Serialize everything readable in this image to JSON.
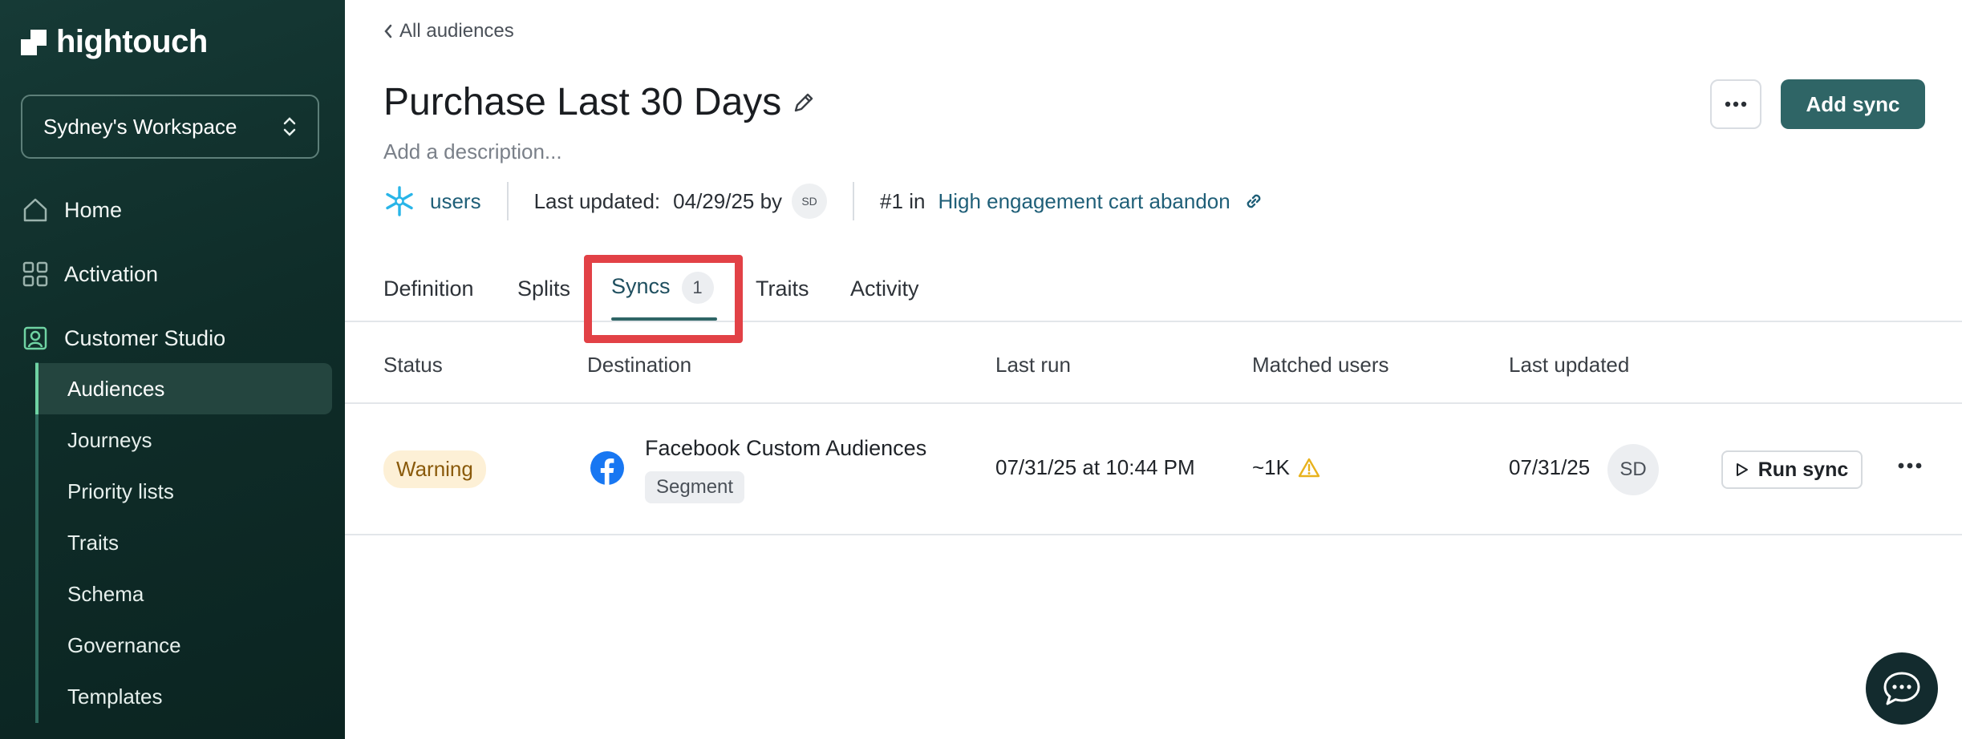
{
  "sidebar": {
    "brand": "hightouch",
    "workspace": "Sydney's Workspace",
    "nav": [
      {
        "label": "Home",
        "icon": "home-icon"
      },
      {
        "label": "Activation",
        "icon": "activation-icon"
      },
      {
        "label": "Customer Studio",
        "icon": "customer-studio-icon"
      }
    ],
    "sub_items": [
      "Audiences",
      "Journeys",
      "Priority lists",
      "Traits",
      "Schema",
      "Governance",
      "Templates"
    ],
    "active_sub": "Audiences"
  },
  "header": {
    "back_label": "All audiences",
    "title": "Purchase Last 30 Days",
    "description_placeholder": "Add a description...",
    "source": "users",
    "last_updated_label": "Last updated:",
    "last_updated_value": "04/29/25 by",
    "updated_by_initials": "SD",
    "rank_label": "#1 in",
    "rank_link": "High engagement cart abandon",
    "add_sync_label": "Add sync"
  },
  "tabs": [
    {
      "label": "Definition"
    },
    {
      "label": "Splits"
    },
    {
      "label": "Syncs",
      "count": "1",
      "active": true
    },
    {
      "label": "Traits"
    },
    {
      "label": "Activity"
    }
  ],
  "table": {
    "columns": [
      "Status",
      "Destination",
      "Last run",
      "Matched users",
      "Last updated"
    ],
    "rows": [
      {
        "status": "Warning",
        "destination": "Facebook Custom Audiences",
        "destination_tag": "Segment",
        "last_run": "07/31/25 at 10:44 PM",
        "matched_users": "~1K",
        "last_updated": "07/31/25",
        "owner_initials": "SD",
        "action": "Run sync"
      }
    ]
  },
  "colors": {
    "sidebar_bg": "#0f2d29",
    "primary": "#2f6566",
    "link": "#1f5f78",
    "highlight": "#e24146",
    "warning_bg": "#fdf0d6",
    "warning_text": "#8a5a0b"
  }
}
